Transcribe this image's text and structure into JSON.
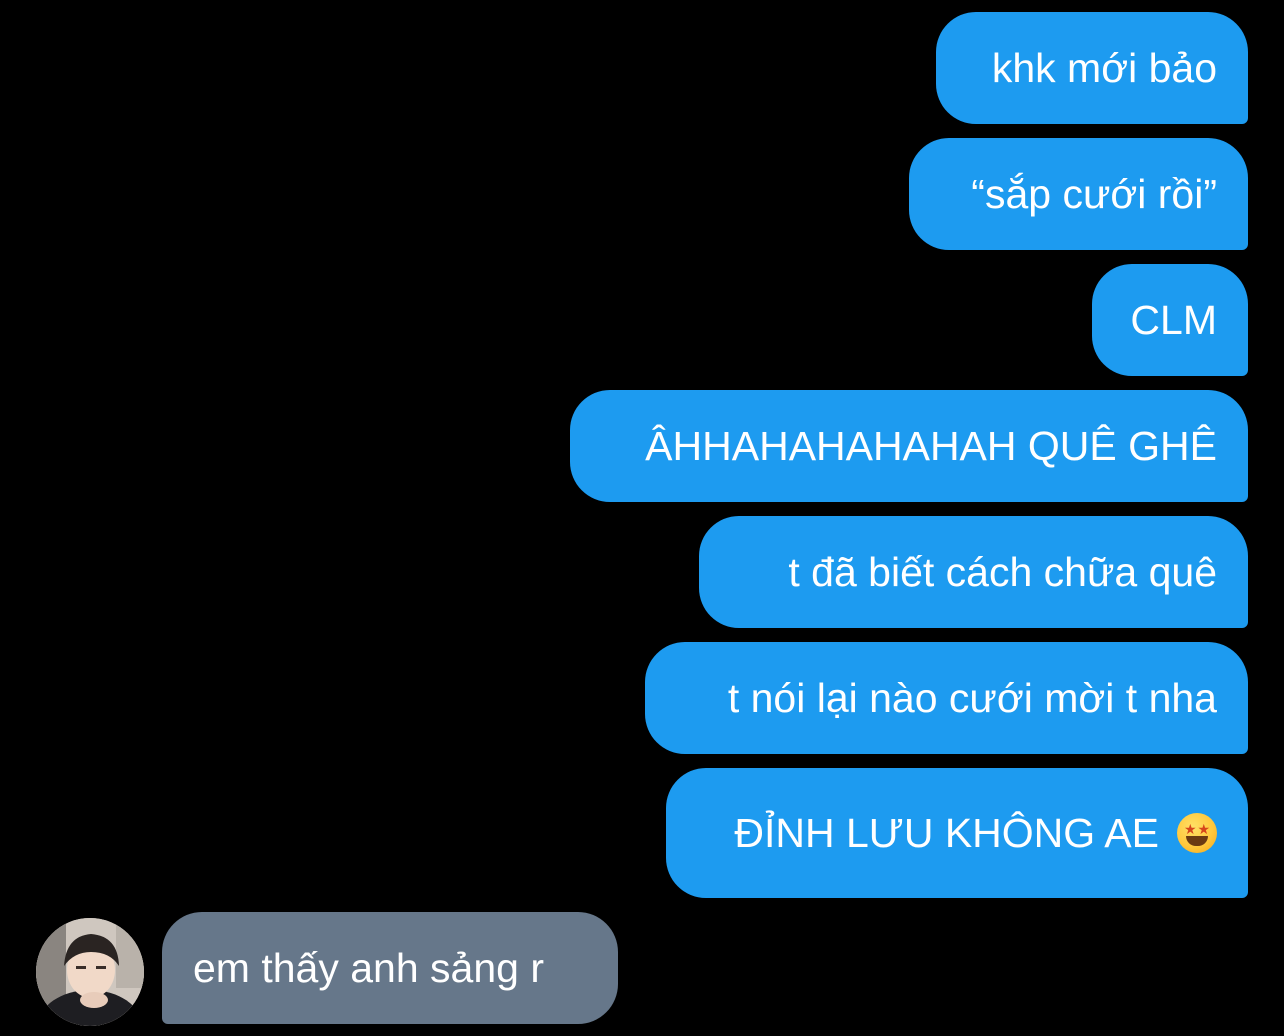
{
  "conversation": {
    "outgoing_messages": [
      {
        "text": "khk mới bảo"
      },
      {
        "text": "“sắp cưới rồi”"
      },
      {
        "text": "CLM"
      },
      {
        "text": "ÂHHAHAHAHAHAH QUÊ GHÊ"
      },
      {
        "text": "t đã biết cách chữa quê"
      },
      {
        "text": "t nói lại nào cưới mời t nha"
      },
      {
        "text": "ĐỈNH LƯU KHÔNG AE",
        "emoji": "star-struck-emoji"
      }
    ],
    "incoming_messages": [
      {
        "text": "em thấy anh sảng r",
        "avatar": "user-avatar"
      }
    ]
  },
  "colors": {
    "background": "#000000",
    "outgoing_bubble": "#1d9bf0",
    "incoming_bubble": "#66778a",
    "text": "#ffffff"
  }
}
